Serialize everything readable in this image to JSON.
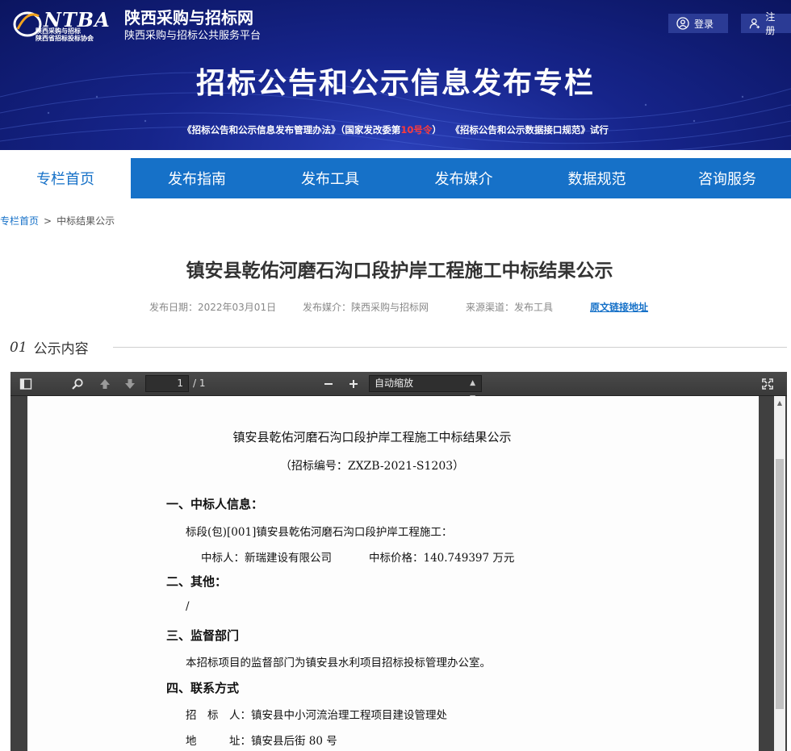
{
  "header": {
    "logo_text": "NTBA",
    "logo_sub_line1": "陕西采购与招标",
    "logo_sub_line2": "陕西省招标投标协会",
    "site_name": "陕西采购与招标网",
    "site_subtitle": "陕西采购与招标公共服务平台",
    "login_label": "登录",
    "register_label": "注册",
    "banner_title": "招标公告和公示信息发布专栏",
    "notice_part1": "《招标公告和公示信息发布管理办法》（国家发改委第",
    "notice_red": "10号令",
    "notice_part2": "）　　《招标公告和公示数据接口规范》试行"
  },
  "nav": {
    "items": [
      "专栏首页",
      "发布指南",
      "发布工具",
      "发布媒介",
      "数据规范",
      "咨询服务"
    ],
    "active_index": 0
  },
  "breadcrumb": {
    "home": "专栏首页",
    "separator": ">",
    "current": "中标结果公示"
  },
  "article": {
    "title": "镇安县乾佑河磨石沟口段护岸工程施工中标结果公示",
    "publish_date": "发布日期：2022年03月01日",
    "publish_media": "发布媒介：陕西采购与招标网",
    "source": "来源渠道：发布工具",
    "original_link": "原文链接地址"
  },
  "section": {
    "number": "01",
    "label": "公示内容"
  },
  "viewer": {
    "page_current": "1",
    "page_total": "/ 1",
    "zoom": "自动缩放",
    "icons": [
      "sidebar-toggle-icon",
      "search-icon",
      "previous-page-icon",
      "next-page-icon",
      "zoom-out-icon",
      "zoom-in-icon",
      "fullscreen-icon"
    ]
  },
  "document": {
    "title": "镇安县乾佑河磨石沟口段护岸工程施工中标结果公示",
    "bid_number": "（招标编号：ZXZB-2021-S1203）",
    "s1_heading": "一、中标人信息：",
    "s1_lot": "标段(包)[001]镇安县乾佑河磨石沟口段护岸工程施工：",
    "s1_winner": "中标人：新瑞建设有限公司",
    "s1_price": "中标价格：140.749397 万元",
    "s2_heading": "二、其他：",
    "s2_body": "/",
    "s3_heading": "三、监督部门",
    "s3_body": "本招标项目的监督部门为镇安县水利项目招标投标管理办公室。",
    "s4_heading": "四、联系方式",
    "s4_tenderer": "招　标　人：镇安县中小河流治理工程项目建设管理处",
    "s4_address": "地　　　址：镇安县后街 80 号"
  }
}
